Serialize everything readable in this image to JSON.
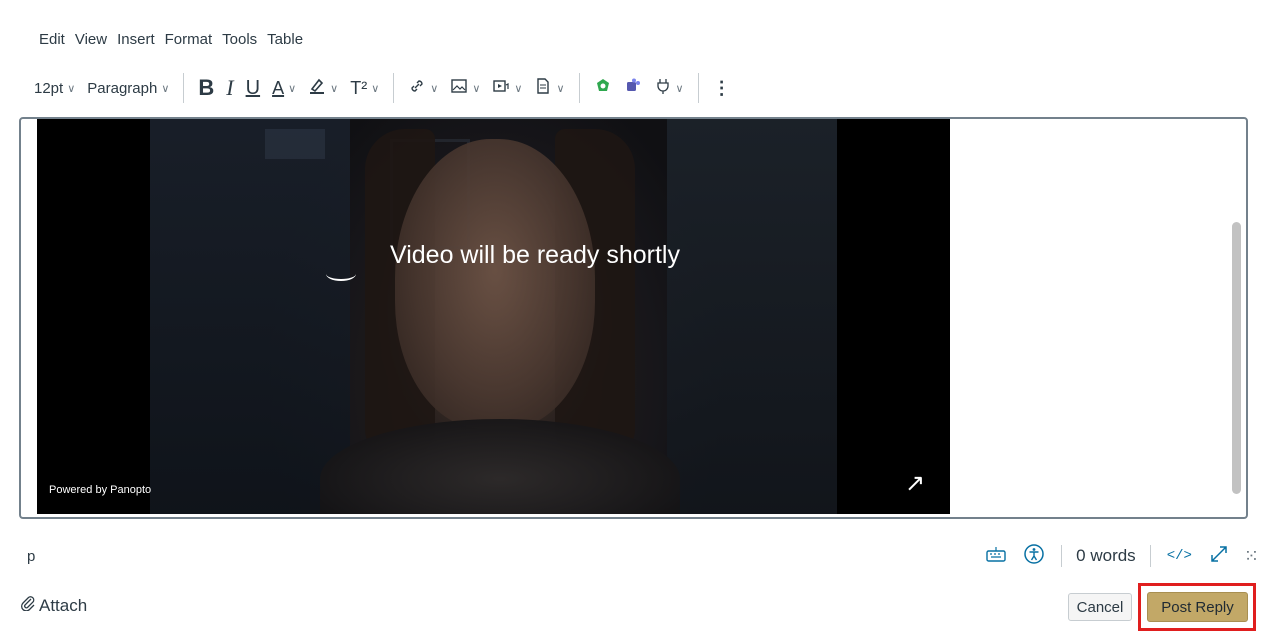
{
  "menubar": {
    "items": [
      "Edit",
      "View",
      "Insert",
      "Format",
      "Tools",
      "Table"
    ]
  },
  "toolbar": {
    "font_size": "12pt",
    "block_format": "Paragraph",
    "bold": "B",
    "italic": "I",
    "underline": "U",
    "text_color": "A",
    "superscript": "T²"
  },
  "icons": {
    "chevron": "chevron-down-icon",
    "highlight": "highlighter-icon",
    "link": "link-icon",
    "image": "image-icon",
    "media": "media-icon",
    "document": "document-icon",
    "app1": "panopto-icon",
    "app2": "teams-icon",
    "plugin": "plug-icon",
    "more": "more-vertical-icon",
    "keyboard": "keyboard-icon",
    "accessibility": "accessibility-icon",
    "html": "html-editor-icon",
    "fullscreen": "fullscreen-icon",
    "resize": "resize-grip-icon",
    "paperclip": "paperclip-icon"
  },
  "video": {
    "status_text": "Video will be ready shortly",
    "powered_by": "Powered by Panopto"
  },
  "statusbar": {
    "element_path": "p",
    "word_count": "0 words",
    "html_label": "</>"
  },
  "footer": {
    "attach_label": "Attach",
    "cancel_label": "Cancel",
    "post_reply_label": "Post Reply"
  },
  "colors": {
    "accent_blue": "#0770a3",
    "post_button": "#c2a867",
    "highlight_box": "#e01e1e"
  }
}
